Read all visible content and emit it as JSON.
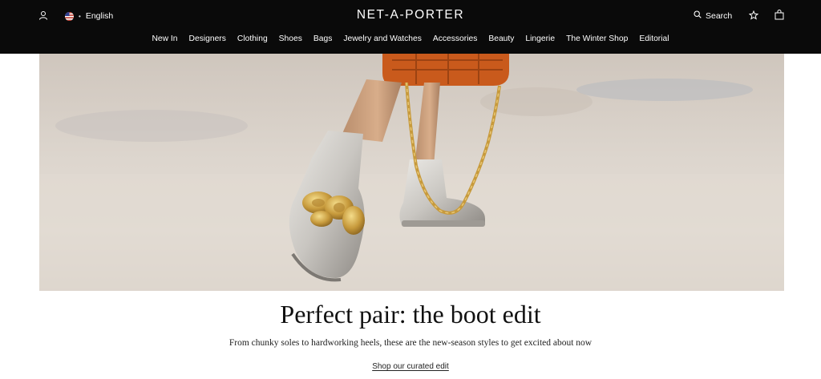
{
  "header": {
    "language": "English",
    "logo": "NET-A-PORTER",
    "search_label": "Search"
  },
  "nav": {
    "items": [
      "New In",
      "Designers",
      "Clothing",
      "Shoes",
      "Bags",
      "Jewelry and Watches",
      "Accessories",
      "Beauty",
      "Lingerie",
      "The Winter Shop",
      "Editorial"
    ]
  },
  "hero": {
    "headline": "Perfect pair: the boot edit",
    "subline": "From chunky soles to hardworking heels, these are the new-season styles to get excited about now",
    "cta": "Shop our curated edit"
  },
  "colors": {
    "header_bg": "#0a0a0a",
    "text": "#111111",
    "bag": "#c95a1c",
    "gold": "#c79a3c"
  }
}
